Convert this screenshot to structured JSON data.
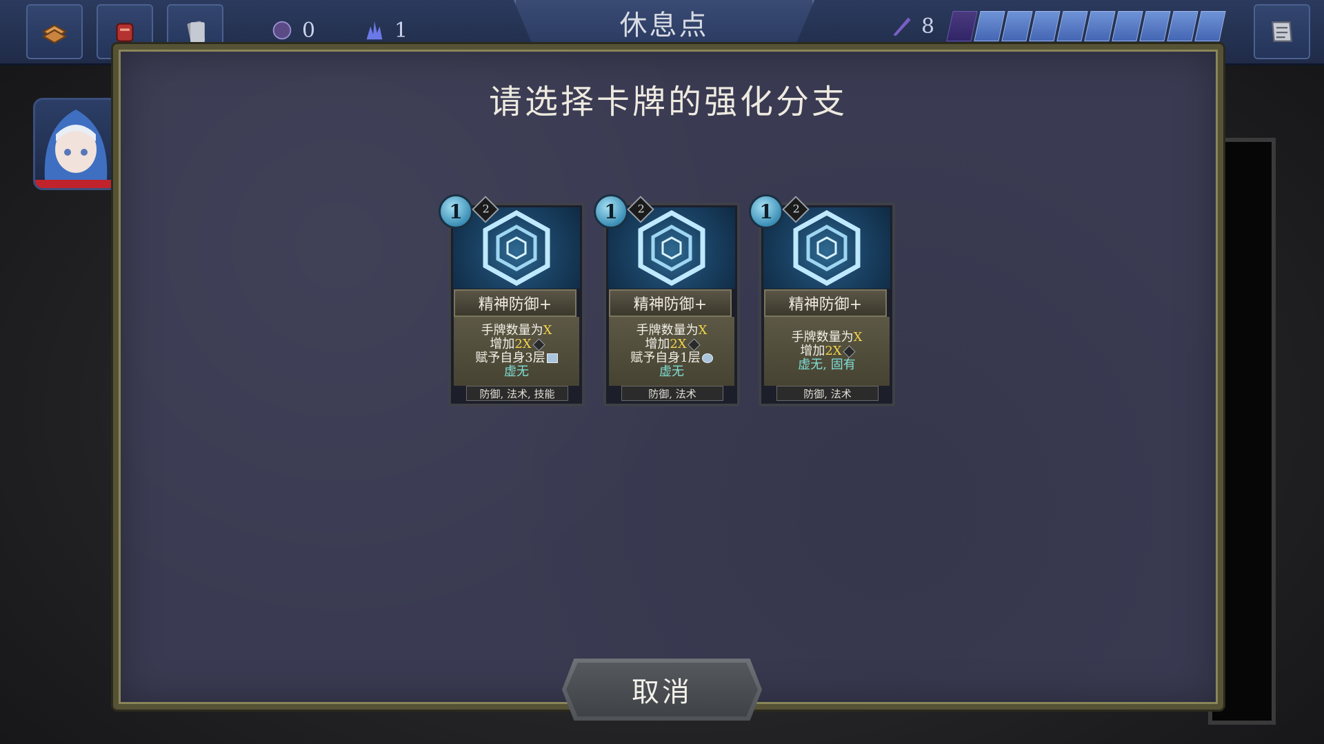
{
  "topbar": {
    "title": "休息点",
    "resources": [
      {
        "icon": "crystal-orb-icon",
        "value": "0"
      },
      {
        "icon": "blue-flame-icon",
        "value": "1"
      }
    ],
    "deck_count": "8",
    "buttons": [
      "deck-icon",
      "relic-icon",
      "card-pile-icon",
      "map-scroll-icon"
    ]
  },
  "modal": {
    "title": "请选择卡牌的强化分支",
    "cancel_label": "取消"
  },
  "cards": [
    {
      "cost": "1",
      "gem": "2",
      "name": "精神防御+",
      "line1_prefix": "手牌数量为",
      "line1_var": "X",
      "line2_prefix": "增加",
      "line2_var": "2X",
      "line3": "赋予自身3层",
      "keyword": "虚无",
      "tags": "防御, 法术, 技能"
    },
    {
      "cost": "1",
      "gem": "2",
      "name": "精神防御+",
      "line1_prefix": "手牌数量为",
      "line1_var": "X",
      "line2_prefix": "增加",
      "line2_var": "2X",
      "line3": "赋予自身1层",
      "keyword": "虚无",
      "tags": "防御, 法术"
    },
    {
      "cost": "1",
      "gem": "2",
      "name": "精神防御+",
      "line1_prefix": "手牌数量为",
      "line1_var": "X",
      "line2_prefix": "增加",
      "line2_var": "2X",
      "line3": "",
      "keyword": "虚无, 固有",
      "tags": "防御, 法术"
    }
  ],
  "colors": {
    "accent_yellow": "#f2d54b",
    "keyword_cyan": "#7fe0d8",
    "hp_red": "#c0232b"
  }
}
